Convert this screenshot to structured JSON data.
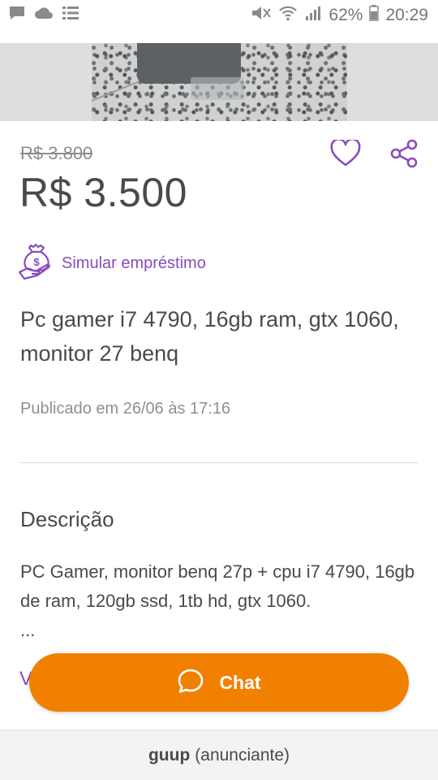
{
  "status_bar": {
    "battery": "62%",
    "time": "20:29",
    "icons": [
      "chat-notification-icon",
      "cloud-icon",
      "list-icon",
      "mute-icon",
      "wifi-icon",
      "signal-icon",
      "battery-icon"
    ]
  },
  "listing": {
    "old_price": "R$ 3.800",
    "price": "R$ 3.500",
    "loan_label": "Simular empréstimo",
    "title": "Pc gamer i7 4790, 16gb ram, gtx 1060, monitor 27 benq",
    "published": "Publicado em 26/06 às 17:16"
  },
  "description": {
    "heading": "Descrição",
    "body": "PC Gamer, monitor benq 27p + cpu i7 4790, 16gb de ram, 120gb ssd, 1tb hd, gtx 1060.",
    "ellipsis": "...",
    "more_label": "V"
  },
  "chat": {
    "label": "Chat"
  },
  "footer": {
    "seller_name": "guup",
    "seller_role": "(anunciante)"
  },
  "colors": {
    "accent_orange": "#f28000",
    "accent_purple": "#8a4bbf",
    "text": "#4a4a4a"
  }
}
